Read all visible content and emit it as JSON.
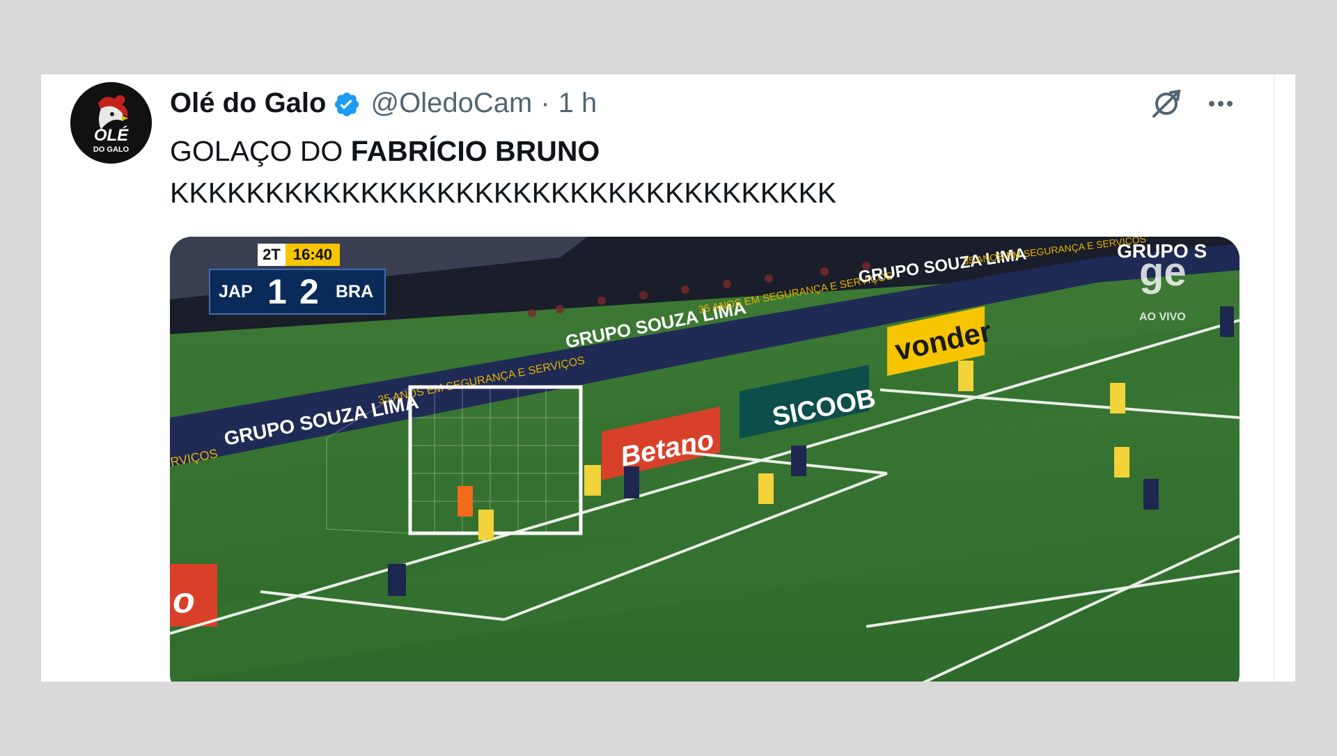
{
  "tweet": {
    "display_name": "Olé do Galo",
    "handle": "@OledoCam",
    "separator": "·",
    "time": "1 h",
    "text_line1_plain": "GOLAÇO DO ",
    "text_line1_bold": "FABRÍCIO BRUNO",
    "text_line2": "KKKKKKKKKKKKKKKKKKKKKKKKKKKKKKKKKKK"
  },
  "avatar": {
    "line1": "OLÉ",
    "line2": "DO GALO"
  },
  "icons": {
    "verified": "verified-badge-icon",
    "grok": "grok-icon",
    "more": "more-options-icon"
  },
  "colors": {
    "verified": "#1d9bf0",
    "text": "#0f1419",
    "muted": "#536471"
  },
  "media": {
    "period": "2T",
    "clock": "16:40",
    "team_home": "JAP",
    "score_home": "1",
    "score_away": "2",
    "team_away": "BRA",
    "broadcaster_logo": "ge",
    "broadcaster_tag": "AO VIVO",
    "ad_souza_lima": "GRUPO SOUZA LIMA",
    "ad_souza_slogan": "35 ANOS EM SEGURANÇA E SERVIÇOS",
    "ad_souza_fragment": "RVIÇOS",
    "ad_grupo_s": "GRUPO S",
    "ad_vonder": "vonder",
    "ad_sicoob": "SICOOB",
    "ad_betano": "Betano",
    "ad_fragment": "o"
  }
}
